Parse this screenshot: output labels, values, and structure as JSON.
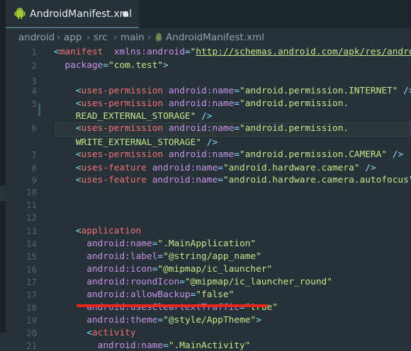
{
  "tab": {
    "title": "AndroidManifest.xml",
    "icon": "android-icon"
  },
  "breadcrumb": [
    "android",
    "app",
    "src",
    "main",
    "AndroidManifest.xml"
  ],
  "colors": {
    "tag": "#f07178",
    "attr": "#c792ea",
    "string": "#c3e88d",
    "punct": "#89ddff",
    "annotation": "#e8281c"
  },
  "lines": [
    {
      "n": "1",
      "segs": [
        [
          "p",
          "<"
        ],
        [
          "t",
          "manifest"
        ],
        [
          "",
          "  "
        ],
        [
          "a",
          "xmlns:android"
        ],
        [
          "p",
          "="
        ],
        [
          "s",
          "\""
        ],
        [
          "u",
          "http://schemas.android.com/apk/res/android"
        ],
        [
          "s",
          "\""
        ]
      ]
    },
    {
      "n": "2",
      "segs": [
        [
          "",
          "  "
        ],
        [
          "a",
          "package"
        ],
        [
          "p",
          "="
        ],
        [
          "s",
          "\"com.test\""
        ],
        [
          "p",
          ">"
        ]
      ]
    },
    {
      "n": "3",
      "segs": []
    },
    {
      "n": "4",
      "segs": [
        [
          "",
          "    "
        ],
        [
          "p",
          "<"
        ],
        [
          "t",
          "uses-permission"
        ],
        [
          "",
          ""
        ],
        [
          "a",
          " android:name"
        ],
        [
          "p",
          "="
        ],
        [
          "s",
          "\"android.permission.INTERNET\""
        ],
        [
          "",
          " "
        ],
        [
          "p",
          "/>"
        ]
      ]
    },
    {
      "n": "5",
      "segs": [
        [
          "",
          "    "
        ],
        [
          "p",
          "<"
        ],
        [
          "t",
          "uses-permission"
        ],
        [
          "a",
          " android:name"
        ],
        [
          "p",
          "="
        ],
        [
          "s",
          "\"android.permission."
        ]
      ]
    },
    {
      "n": "",
      "segs": [
        [
          "s",
          "    READ_EXTERNAL_STORAGE\""
        ],
        [
          "",
          " "
        ],
        [
          "p",
          "/>"
        ]
      ]
    },
    {
      "n": "6",
      "segs": [
        [
          "",
          "    "
        ],
        [
          "p",
          "<"
        ],
        [
          "t",
          "uses-permission"
        ],
        [
          "a",
          " android:name"
        ],
        [
          "p",
          "="
        ],
        [
          "s",
          "\"android.permission."
        ]
      ]
    },
    {
      "n": "",
      "segs": [
        [
          "s",
          "    WRITE_EXTERNAL_STORAGE\""
        ],
        [
          "",
          " "
        ],
        [
          "p",
          "/>"
        ]
      ]
    },
    {
      "n": "7",
      "segs": [
        [
          "",
          "    "
        ],
        [
          "p",
          "<"
        ],
        [
          "t",
          "uses-permission"
        ],
        [
          "a",
          " android:name"
        ],
        [
          "p",
          "="
        ],
        [
          "s",
          "\"android.permission.CAMERA\""
        ],
        [
          "",
          " "
        ],
        [
          "p",
          "/>"
        ]
      ]
    },
    {
      "n": "8",
      "segs": [
        [
          "",
          "    "
        ],
        [
          "p",
          "<"
        ],
        [
          "t",
          "uses-feature"
        ],
        [
          "a",
          " android:name"
        ],
        [
          "p",
          "="
        ],
        [
          "s",
          "\"android.hardware.camera\""
        ],
        [
          "",
          " "
        ],
        [
          "p",
          "/>"
        ]
      ]
    },
    {
      "n": "9",
      "segs": [
        [
          "",
          "    "
        ],
        [
          "p",
          "<"
        ],
        [
          "t",
          "uses-feature"
        ],
        [
          "a",
          " android:name"
        ],
        [
          "p",
          "="
        ],
        [
          "s",
          "\"android.hardware.camera.autofocus\""
        ],
        [
          "",
          " "
        ],
        [
          "p",
          "/>"
        ]
      ]
    },
    {
      "n": "10",
      "segs": []
    },
    {
      "n": "11",
      "segs": []
    },
    {
      "n": "12",
      "segs": []
    },
    {
      "n": "13",
      "segs": [
        [
          "",
          "    "
        ],
        [
          "p",
          "<"
        ],
        [
          "t",
          "application"
        ]
      ]
    },
    {
      "n": "14",
      "segs": [
        [
          "",
          "      "
        ],
        [
          "a",
          "android:name"
        ],
        [
          "p",
          "="
        ],
        [
          "s",
          "\".MainApplication\""
        ]
      ]
    },
    {
      "n": "15",
      "segs": [
        [
          "",
          "      "
        ],
        [
          "a",
          "android:label"
        ],
        [
          "p",
          "="
        ],
        [
          "s",
          "\"@string/app_name\""
        ]
      ]
    },
    {
      "n": "16",
      "segs": [
        [
          "",
          "      "
        ],
        [
          "a",
          "android:icon"
        ],
        [
          "p",
          "="
        ],
        [
          "s",
          "\"@mipmap/ic_launcher\""
        ]
      ]
    },
    {
      "n": "17",
      "segs": [
        [
          "",
          "      "
        ],
        [
          "a",
          "android:roundIcon"
        ],
        [
          "p",
          "="
        ],
        [
          "s",
          "\"@mipmap/ic_launcher_round\""
        ]
      ]
    },
    {
      "n": "17",
      "segs": [
        [
          "",
          "      "
        ],
        [
          "a",
          "android:allowBackup"
        ],
        [
          "p",
          "="
        ],
        [
          "s",
          "\"false\""
        ]
      ]
    },
    {
      "n": "18",
      "segs": [
        [
          "",
          "      "
        ],
        [
          "a",
          "android:usesCleartextTraffic"
        ],
        [
          "p",
          "="
        ],
        [
          "s",
          "\"true\""
        ]
      ]
    },
    {
      "n": "19",
      "segs": [
        [
          "",
          "      "
        ],
        [
          "a",
          "android:theme"
        ],
        [
          "p",
          "="
        ],
        [
          "s",
          "\"@style/AppTheme\""
        ],
        [
          "p",
          ">"
        ]
      ]
    },
    {
      "n": "20",
      "segs": [
        [
          "",
          "      "
        ],
        [
          "p",
          "<"
        ],
        [
          "t",
          "activity"
        ]
      ]
    },
    {
      "n": "21",
      "segs": [
        [
          "",
          "        "
        ],
        [
          "a",
          "android:name"
        ],
        [
          "p",
          "="
        ],
        [
          "s",
          "\".MainActivity\""
        ]
      ]
    }
  ]
}
